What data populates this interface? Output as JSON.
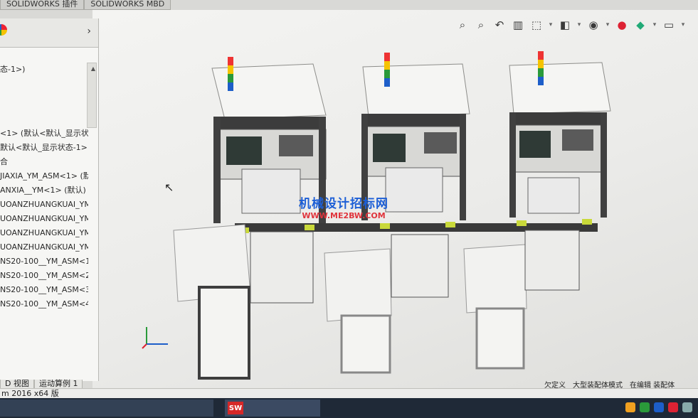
{
  "top_tabs": [
    "SOLIDWORKS 插件",
    "SOLIDWORKS MBD"
  ],
  "toolbar": {
    "icons": [
      "zoom-to-fit-icon",
      "zoom-area-icon",
      "previous-view-icon",
      "section-view-icon",
      "view-orientation-icon",
      "display-style-icon",
      "hide-show-icon",
      "edit-appearance-icon",
      "apply-scene-icon",
      "view-settings-icon",
      "display-screen-icon"
    ]
  },
  "tree": {
    "rows": [
      "态-1>)",
      "<1> (默认<默认_显示状",
      "默认<默认_显示状态-1>",
      "合",
      "JIAXIA_YM_ASM<1> (默",
      "ANXIA__YM<1> (默认)",
      "UOANZHUANGKUAI_YM",
      "UOANZHUANGKUAI_YM",
      "UOANZHUANGKUAI_YM",
      "UOANZHUANGKUAI_YM",
      "NS20-100__YM_ASM<1>",
      "NS20-100__YM_ASM<2>",
      "NS20-100__YM_ASM<3>",
      "NS20-100__YM_ASM<4>"
    ]
  },
  "bottom_tabs": [
    "D 视图",
    "运动算例 1"
  ],
  "status": {
    "left": "m 2016 x64 版",
    "right": "欠定义　大型装配体模式　在编辑 装配体"
  },
  "watermark": {
    "title": "机械设计招标网",
    "url": "WWW.ME2BW.COM"
  },
  "taskbar": {
    "sw_logo": "SW"
  },
  "colors": {
    "tree_link": "#1c5ed6",
    "watermark_title": "#1c5ed6",
    "watermark_url": "#e0343c"
  }
}
